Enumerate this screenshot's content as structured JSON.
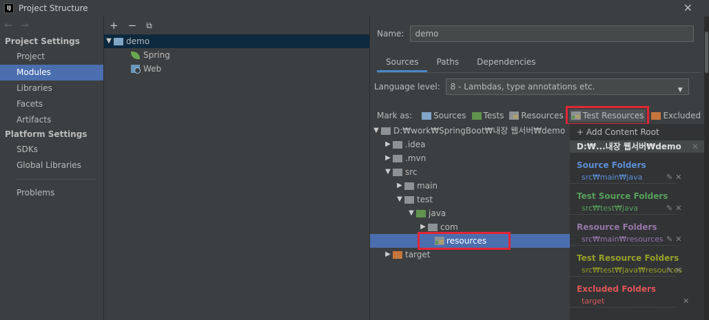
{
  "window": {
    "title": "Project Structure",
    "app_icon_text": "IJ"
  },
  "sidebar": {
    "sections": [
      {
        "title": "Project Settings",
        "items": [
          "Project",
          "Modules",
          "Libraries",
          "Facets",
          "Artifacts"
        ]
      },
      {
        "title": "Platform Settings",
        "items": [
          "SDKs",
          "Global Libraries"
        ]
      }
    ],
    "extra": "Problems",
    "selected": "Modules"
  },
  "modules": {
    "root": "demo",
    "children": [
      "Spring",
      "Web"
    ]
  },
  "details": {
    "name_label": "Name:",
    "name_value": "demo",
    "tabs": [
      "Sources",
      "Paths",
      "Dependencies"
    ],
    "selected_tab": "Sources",
    "language_label": "Language level:",
    "language_value": "8 - Lambdas, type annotations etc.",
    "mark_as_label": "Mark as:",
    "mark_buttons": [
      "Sources",
      "Tests",
      "Resources",
      "Test Resources",
      "Excluded"
    ]
  },
  "tree": {
    "root": "D:₩work₩SpringBoot₩내장 웹서버₩demo",
    "rows": [
      ".idea",
      ".mvn",
      "src",
      "main",
      "test",
      "java",
      "com",
      "resources",
      "target"
    ]
  },
  "content_roots": {
    "add_label": "+ Add Content Root",
    "root_path": "D:₩...내장 웹서버₩demo",
    "groups": [
      {
        "title": "Source Folders",
        "path": "src₩main₩java",
        "color": "#5c8fd6"
      },
      {
        "title": "Test Source Folders",
        "path": "src₩test₩java",
        "color": "#58a05a"
      },
      {
        "title": "Resource Folders",
        "path": "src₩main₩resources",
        "color": "#9876aa"
      },
      {
        "title": "Test Resource Folders",
        "path": "src₩test₩java₩resources",
        "color": "#96a028"
      },
      {
        "title": "Excluded Folders",
        "path": "target",
        "color": "#e05555"
      }
    ]
  }
}
